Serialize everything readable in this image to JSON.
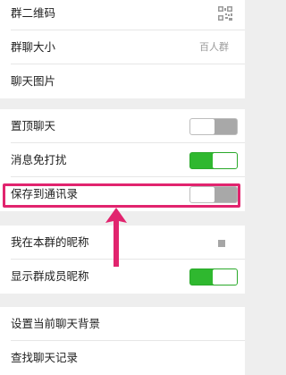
{
  "rows": {
    "qrcode": {
      "label": "群二维码",
      "icon": "qr-code-icon"
    },
    "size": {
      "label": "群聊大小",
      "value": "百人群"
    },
    "images": {
      "label": "聊天图片"
    },
    "pin": {
      "label": "置顶聊天",
      "toggle": false
    },
    "mute": {
      "label": "消息免打扰",
      "toggle": true
    },
    "save": {
      "label": "保存到通讯录",
      "toggle": false
    },
    "nickname": {
      "label": "我在本群的昵称"
    },
    "show_names": {
      "label": "显示群成员昵称",
      "toggle": true
    },
    "background": {
      "label": "设置当前聊天背景"
    },
    "search": {
      "label": "查找聊天记录"
    }
  },
  "colors": {
    "toggle_on": "#2fb82f",
    "toggle_off": "#a8a8a8",
    "highlight": "#e1246e"
  }
}
